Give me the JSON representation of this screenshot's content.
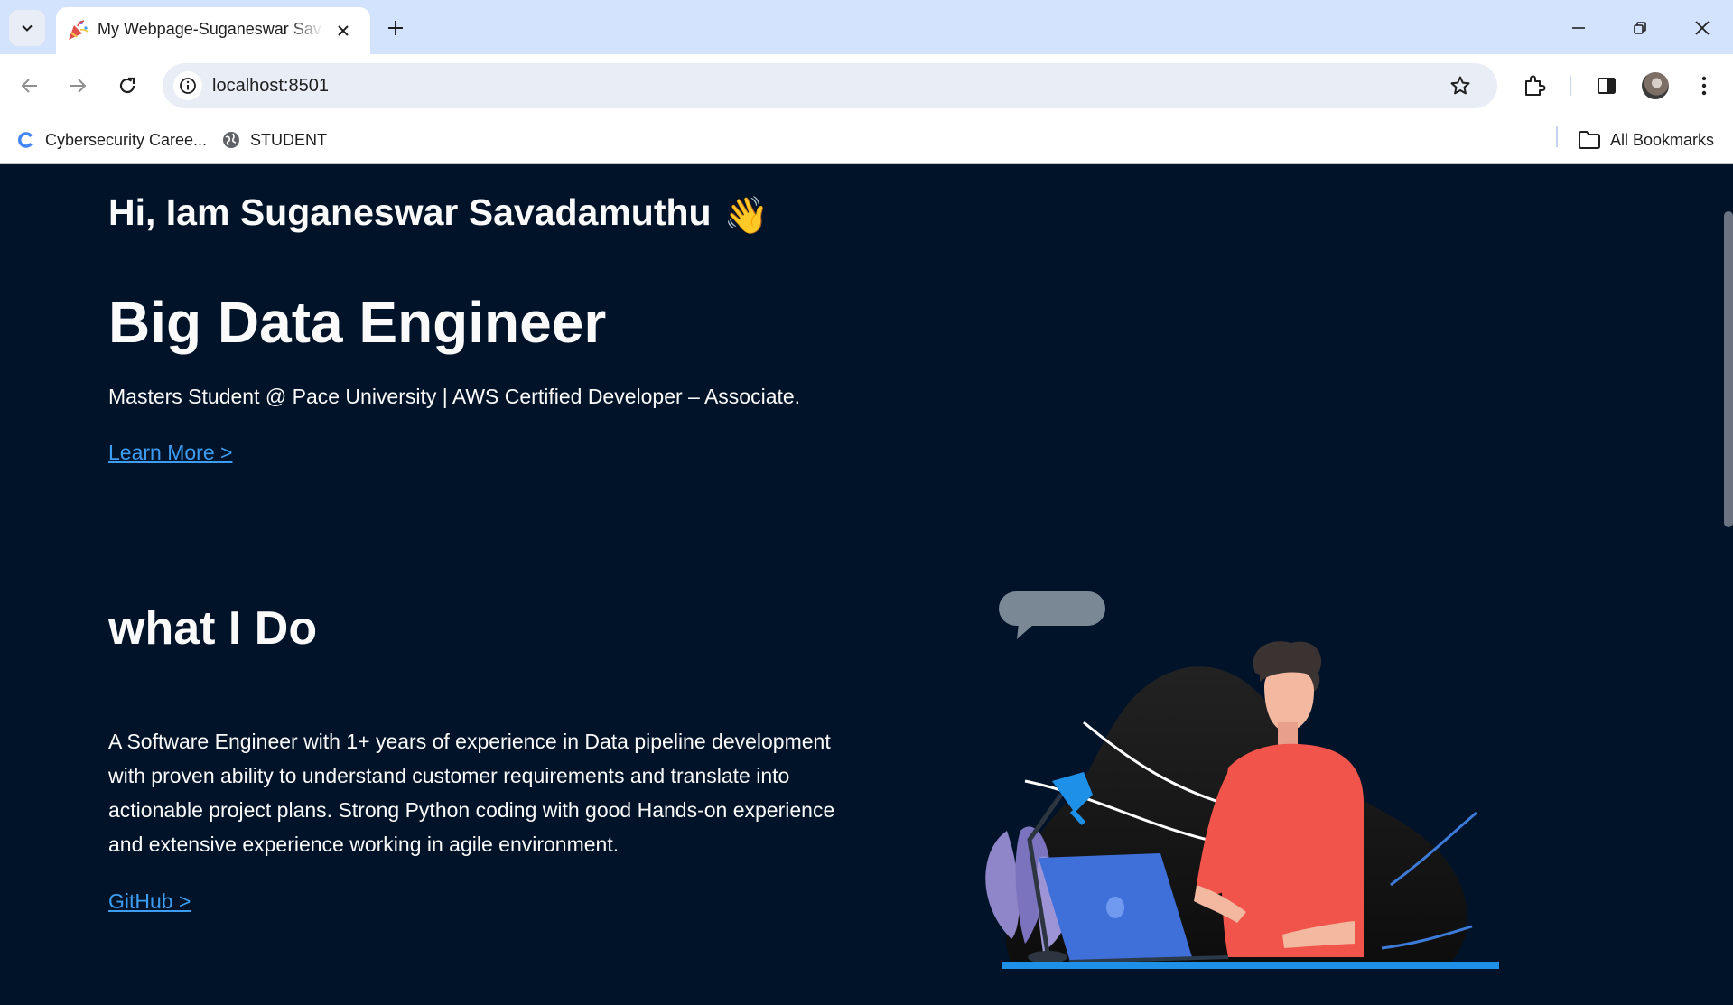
{
  "browser": {
    "tab": {
      "title": "My Webpage-Suganeswar Savadamuthu"
    },
    "address_bar": {
      "url": "localhost:8501"
    },
    "bookmarks": [
      {
        "label": "Cybersecurity Caree...",
        "icon": "chrome-c-icon"
      },
      {
        "label": "STUDENT",
        "icon": "globe-icon"
      }
    ],
    "all_bookmarks_label": "All Bookmarks"
  },
  "hero": {
    "greeting": "Hi, Iam Suganeswar Savadamuthu",
    "wave_emoji": "👋",
    "title": "Big Data Engineer",
    "subtitle": "Masters Student @ Pace University | AWS Certified Developer – Associate.",
    "learn_more": "Learn More >"
  },
  "about": {
    "title": "what I Do",
    "description": "A Software Engineer with 1+ years of experience in Data pipeline development with proven ability to understand customer requirements and translate into actionable project plans. Strong Python coding with good Hands-on experience and extensive experience working in agile environment.",
    "github": "GitHub >"
  },
  "colors": {
    "background": "#001329",
    "text": "#fafafa",
    "link": "#3d9df3",
    "browser_frame": "#d3e3fd"
  }
}
